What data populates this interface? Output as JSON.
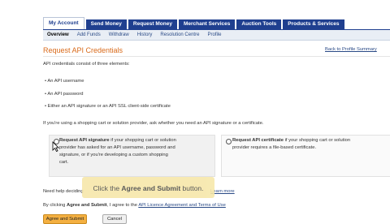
{
  "top_tabs": [
    "My Account",
    "Send Money",
    "Request Money",
    "Merchant Services",
    "Auction Tools",
    "Products & Services"
  ],
  "sub_tabs": [
    "Overview",
    "Add Funds",
    "Withdraw",
    "History",
    "Resolution Centre",
    "Profile"
  ],
  "page": {
    "title": "Request API Credentials",
    "back_link": "Back to Profile Summary",
    "intro": "API credentials consist of three elements:",
    "bullets": [
      "An API username",
      "An API password",
      "Either an API signature or an API SSL client-side certificate"
    ],
    "question": "If you're using a shopping cart or solution provider, ask whether you need an API signature or a certificate."
  },
  "options": {
    "signature_title": "Request API signature",
    "signature_desc_lines": [
      "if your shopping cart or solution",
      "provider has asked for an API username, password and",
      "signature, or if you're developing a custom shopping",
      "cart."
    ],
    "certificate_title": "Request API certificate",
    "certificate_desc_lines": [
      "if your shopping cart or solution",
      "provider requires a file-based certificate."
    ]
  },
  "help": {
    "text": "Need help deciding",
    "link": "Learn more"
  },
  "agreement": {
    "prefix": "By clicking",
    "b1": "Agree and Submit",
    "mid": ", I agree to the",
    "link": "API Licence Agreement and Terms of Use"
  },
  "buttons": {
    "submit": "Agree and Submit",
    "cancel": "Cancel"
  },
  "caption": {
    "pre": "Click the",
    "bold": "Agree and Submit",
    "post": "button."
  }
}
